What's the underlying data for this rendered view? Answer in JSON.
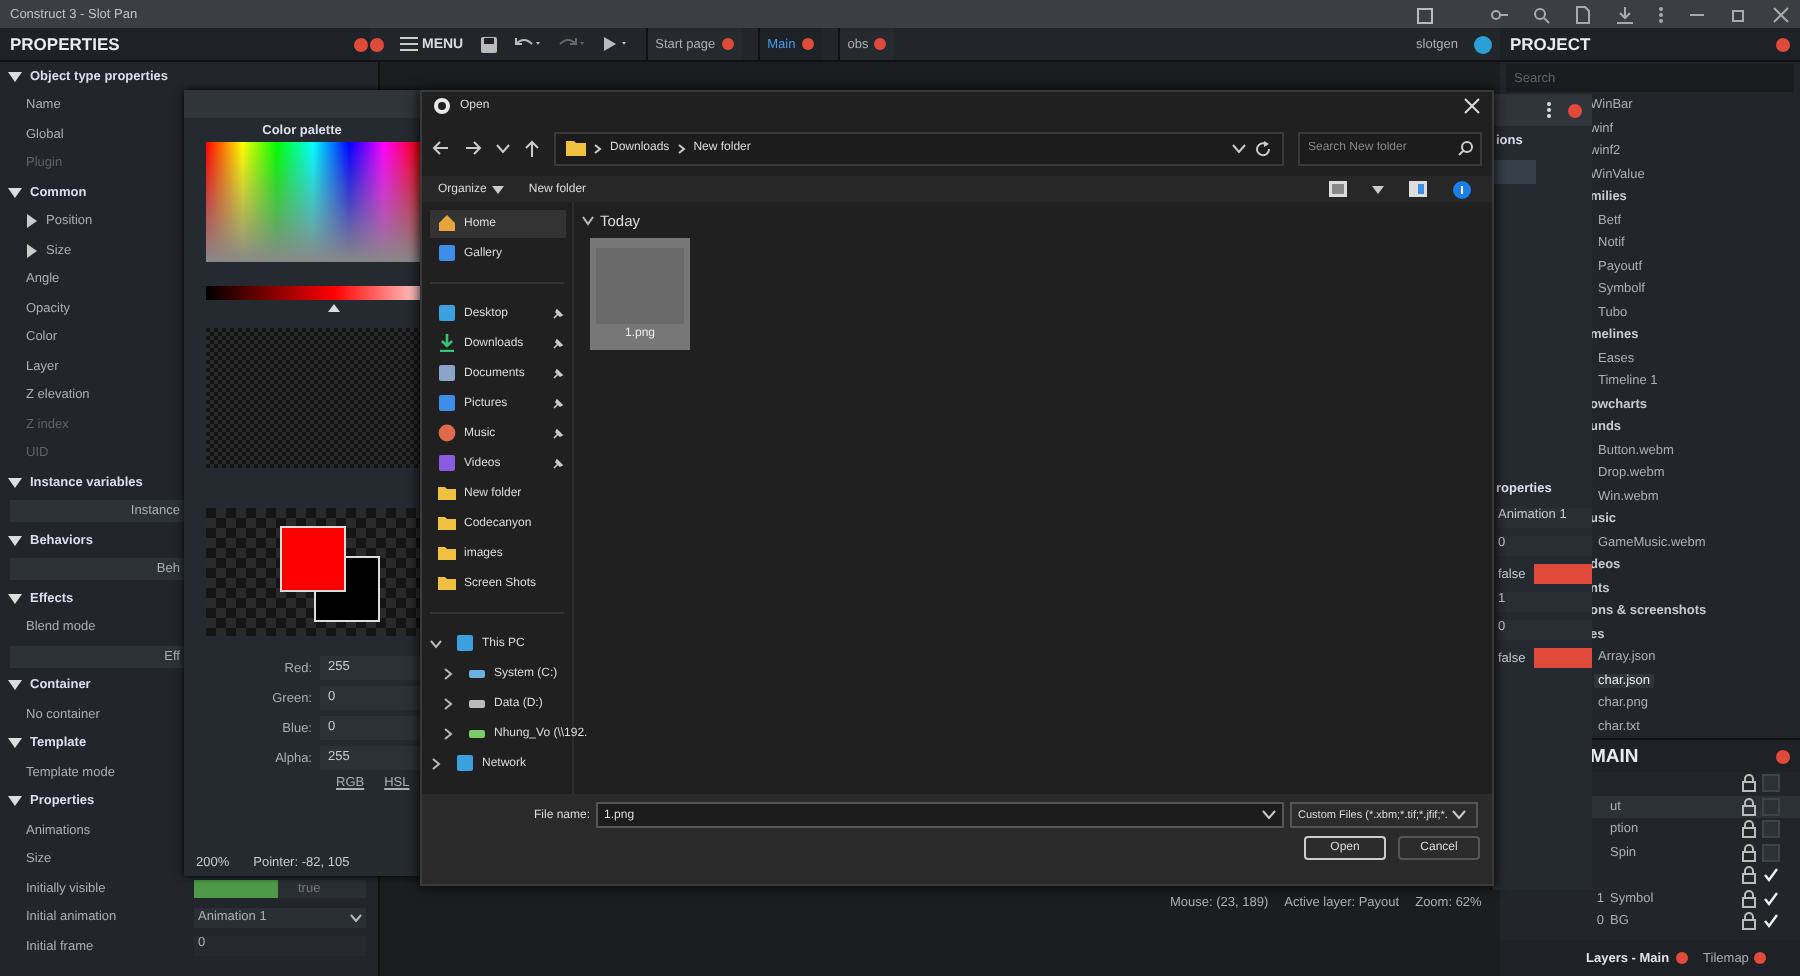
{
  "window": {
    "title": "Construct 3 - Slot Pan"
  },
  "properties_panel": {
    "title": "PROPERTIES",
    "sections": [
      {
        "title": "Object type properties",
        "expanded": true,
        "rows": [
          {
            "kind": "prop",
            "label": "Name",
            "disabled": false
          },
          {
            "kind": "prop",
            "label": "Global",
            "disabled": false
          },
          {
            "kind": "prop",
            "label": "Plugin",
            "disabled": true
          }
        ]
      },
      {
        "title": "Common",
        "expanded": true,
        "rows": [
          {
            "kind": "group",
            "label": "Position",
            "expanded": false,
            "disabled": false
          },
          {
            "kind": "group",
            "label": "Size",
            "expanded": false,
            "disabled": false
          },
          {
            "kind": "prop",
            "label": "Angle",
            "disabled": false
          },
          {
            "kind": "prop",
            "label": "Opacity",
            "disabled": false
          },
          {
            "kind": "prop",
            "label": "Color",
            "disabled": false
          },
          {
            "kind": "prop",
            "label": "Layer",
            "disabled": false
          },
          {
            "kind": "prop",
            "label": "Z elevation",
            "disabled": false
          },
          {
            "kind": "prop",
            "label": "Z index",
            "disabled": true
          },
          {
            "kind": "prop",
            "label": "UID",
            "disabled": true
          }
        ]
      },
      {
        "title": "Instance variables",
        "expanded": true,
        "rows": [
          {
            "kind": "button",
            "label": "Instance",
            "disabled": false
          }
        ]
      },
      {
        "title": "Behaviors",
        "expanded": true,
        "rows": [
          {
            "kind": "button",
            "label": "Beh",
            "disabled": false
          }
        ]
      },
      {
        "title": "Effects",
        "expanded": true,
        "rows": [
          {
            "kind": "prop",
            "label": "Blend mode",
            "disabled": false
          },
          {
            "kind": "button",
            "label": "Eff",
            "disabled": false
          }
        ]
      },
      {
        "title": "Container",
        "expanded": true,
        "rows": [
          {
            "kind": "prop",
            "label": "No container",
            "disabled": false
          }
        ]
      },
      {
        "title": "Template",
        "expanded": true,
        "rows": [
          {
            "kind": "prop",
            "label": "Template mode",
            "disabled": false
          }
        ]
      },
      {
        "title": "Properties",
        "expanded": true,
        "rows": [
          {
            "kind": "prop",
            "label": "Animations",
            "disabled": false
          },
          {
            "kind": "prop",
            "label": "Size",
            "disabled": false
          },
          {
            "kind": "toggle",
            "label": "Initially visible",
            "value": "true",
            "on": true,
            "disabled": false
          },
          {
            "kind": "select",
            "label": "Initial animation",
            "value": "Animation 1",
            "disabled": false
          },
          {
            "kind": "number",
            "label": "Initial frame",
            "value": "0",
            "disabled": false
          }
        ]
      }
    ]
  },
  "toolbar": {
    "menu": "MENU",
    "tabs": [
      {
        "label": "Start page",
        "selected": false
      },
      {
        "label": "Main",
        "selected": true
      },
      {
        "label": "obs",
        "selected": false
      }
    ],
    "user": "slotgen"
  },
  "status_bar": [
    "Mouse: (23, 189)",
    "Active layer: Payout",
    "Zoom: 62%"
  ],
  "color_palette": {
    "title": "Color palette",
    "brightness_slider": {
      "level": 0.6
    },
    "preview": [
      {
        "color": "#ff0000"
      },
      {
        "color": "#000000"
      }
    ],
    "fields": [
      {
        "label": "Red:",
        "value": "255"
      },
      {
        "label": "Green:",
        "value": "0"
      },
      {
        "label": "Blue:",
        "value": "0"
      },
      {
        "label": "Alpha:",
        "value": "255"
      }
    ],
    "modes": [
      "RGB",
      "HSL"
    ],
    "zoom": "200%",
    "pointer": "Pointer: -82, 105"
  },
  "open_dialog": {
    "title": "Open",
    "path": [
      "Downloads",
      "New folder"
    ],
    "search": {
      "placeholder": "Search New folder"
    },
    "commands": [
      {
        "label": "Organize",
        "menu": true
      },
      {
        "label": "New folder",
        "menu": false
      }
    ],
    "nav_groups": [
      [
        {
          "kind": "home",
          "label": "Home",
          "selected": true,
          "pinned": false
        },
        {
          "kind": "gallery",
          "label": "Gallery",
          "selected": false,
          "pinned": false
        }
      ],
      [
        {
          "kind": "desktop",
          "label": "Desktop",
          "selected": false,
          "pinned": true
        },
        {
          "kind": "downloads",
          "label": "Downloads",
          "selected": false,
          "pinned": true
        },
        {
          "kind": "documents",
          "label": "Documents",
          "selected": false,
          "pinned": true
        },
        {
          "kind": "pictures",
          "label": "Pictures",
          "selected": false,
          "pinned": true
        },
        {
          "kind": "music",
          "label": "Music",
          "selected": false,
          "pinned": true
        },
        {
          "kind": "videos",
          "label": "Videos",
          "selected": false,
          "pinned": true
        },
        {
          "kind": "folder",
          "label": "New folder",
          "selected": false,
          "pinned": false
        },
        {
          "kind": "folder",
          "label": "Codecanyon",
          "selected": false,
          "pinned": false
        },
        {
          "kind": "folder",
          "label": "images",
          "selected": false,
          "pinned": false
        },
        {
          "kind": "folder",
          "label": "Screen Shots",
          "selected": false,
          "pinned": false
        }
      ],
      [
        {
          "kind": "pc",
          "label": "This PC",
          "selected": false,
          "pinned": false,
          "expanded": true,
          "children": [
            {
              "kind": "system",
              "label": "System (C:)",
              "selected": false,
              "pinned": false,
              "expanded": false
            },
            {
              "kind": "drive",
              "label": "Data (D:)",
              "selected": false,
              "pinned": false,
              "expanded": false
            },
            {
              "kind": "netdrive",
              "label": "Nhung_Vo (\\\\192.",
              "selected": false,
              "pinned": false,
              "expanded": false
            }
          ]
        },
        {
          "kind": "network",
          "label": "Network",
          "selected": false,
          "pinned": false,
          "expanded": false
        }
      ]
    ],
    "groups": [
      {
        "label": "Today",
        "expanded": true,
        "files": [
          {
            "name": "1.png",
            "selected": true
          }
        ]
      }
    ],
    "file_name_label": "File name:",
    "file_name": "1.png",
    "filter": "Custom Files (*.xbm;*.tif;*.jfif;*.",
    "buttons": [
      {
        "label": "Open",
        "default": true
      },
      {
        "label": "Cancel",
        "default": false
      }
    ]
  },
  "animations_panel": {
    "heading": "ions",
    "properties_heading": "roperties",
    "fields": [
      {
        "kind": "select",
        "value": "Animation 1"
      },
      {
        "kind": "number",
        "value": "0"
      },
      {
        "kind": "toggle",
        "value": "false",
        "on": false
      },
      {
        "kind": "number",
        "value": "1"
      },
      {
        "kind": "number",
        "value": "0"
      },
      {
        "kind": "toggle",
        "value": "false",
        "on": false
      }
    ]
  },
  "project_panel": {
    "title": "PROJECT",
    "search": {
      "placeholder": "Search"
    },
    "tree": [
      {
        "label": "WinBar",
        "kind": "item"
      },
      {
        "label": "winf",
        "kind": "item"
      },
      {
        "label": "winf2",
        "kind": "item"
      },
      {
        "label": "WinValue",
        "kind": "item"
      },
      {
        "label": "milies",
        "kind": "folder",
        "children": [
          {
            "label": "Betf",
            "kind": "item"
          },
          {
            "label": "Notif",
            "kind": "item"
          },
          {
            "label": "Payoutf",
            "kind": "item"
          },
          {
            "label": "Symbolf",
            "kind": "item"
          },
          {
            "label": "Tubo",
            "kind": "item"
          }
        ]
      },
      {
        "label": "melines",
        "kind": "folder",
        "children": [
          {
            "label": "Eases",
            "kind": "item"
          },
          {
            "label": "Timeline 1",
            "kind": "item"
          }
        ]
      },
      {
        "label": "owcharts",
        "kind": "folder"
      },
      {
        "label": "unds",
        "kind": "folder",
        "children": [
          {
            "label": "Button.webm",
            "kind": "item"
          },
          {
            "label": "Drop.webm",
            "kind": "item"
          },
          {
            "label": "Win.webm",
            "kind": "item"
          }
        ]
      },
      {
        "label": "usic",
        "kind": "folder",
        "children": [
          {
            "label": "GameMusic.webm",
            "kind": "item"
          }
        ]
      },
      {
        "label": "deos",
        "kind": "folder"
      },
      {
        "label": "nts",
        "kind": "folder"
      },
      {
        "label": "ons & screenshots",
        "kind": "folder"
      },
      {
        "label": "es",
        "kind": "folder",
        "children": [
          {
            "label": "Array.json",
            "kind": "item",
            "selected": false
          },
          {
            "label": "char.json",
            "kind": "item",
            "selected": true
          },
          {
            "label": "char.png",
            "kind": "item",
            "selected": false
          },
          {
            "label": "char.txt",
            "kind": "item",
            "selected": false
          }
        ]
      }
    ]
  },
  "layers_panel": {
    "title": "MAIN",
    "rows": [
      {
        "visible": false,
        "selected": false
      },
      {
        "name": "ut",
        "visible": false,
        "selected": true
      },
      {
        "name": "ption",
        "visible": false,
        "selected": false
      },
      {
        "name": "Spin",
        "visible": false,
        "selected": false
      },
      {
        "visible": true,
        "selected": false
      },
      {
        "index": "1",
        "name": "Symbol",
        "visible": true,
        "selected": false
      },
      {
        "index": "0",
        "name": "BG",
        "visible": true,
        "selected": false
      }
    ]
  },
  "bottom_tabs": [
    {
      "label": "Layers - Main",
      "selected": true
    },
    {
      "label": "Tilemap",
      "selected": false
    }
  ]
}
